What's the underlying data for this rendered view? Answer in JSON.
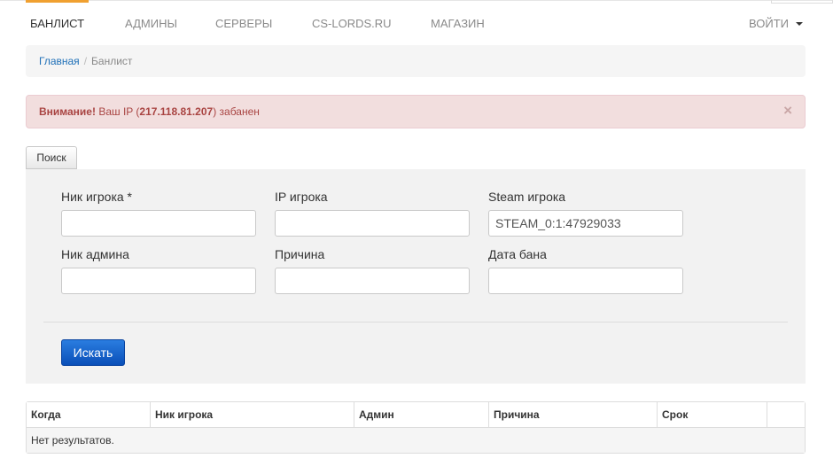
{
  "nav": {
    "items": [
      {
        "label": "Банлист",
        "active": true
      },
      {
        "label": "Админы",
        "active": false
      },
      {
        "label": "Серверы",
        "active": false
      },
      {
        "label": "CS-LORDS.RU",
        "active": false
      },
      {
        "label": "Магазин",
        "active": false
      }
    ],
    "login_label": "Войти",
    "accent_color": "#f0a030"
  },
  "breadcrumb": {
    "home": "Главная",
    "separator": "/",
    "current": "Банлист"
  },
  "alert": {
    "title": "Внимание!",
    "text_before": " Ваш IP (",
    "ip": "217.118.81.207",
    "text_after": ") забанен",
    "close_glyph": "×"
  },
  "search": {
    "tab_label": "Поиск",
    "fields": {
      "player_nick": {
        "label": "Ник игрока *",
        "value": ""
      },
      "player_ip": {
        "label": "IP игрока",
        "value": ""
      },
      "player_steam": {
        "label": "Steam игрока",
        "value": "STEAM_0:1:47929033"
      },
      "admin_nick": {
        "label": "Ник админа",
        "value": ""
      },
      "reason": {
        "label": "Причина",
        "value": ""
      },
      "ban_date": {
        "label": "Дата бана",
        "value": ""
      }
    },
    "submit_label": "Искать"
  },
  "table": {
    "columns": [
      "Когда",
      "Ник игрока",
      "Админ",
      "Причина",
      "Срок",
      ""
    ],
    "empty_text": "Нет результатов."
  }
}
